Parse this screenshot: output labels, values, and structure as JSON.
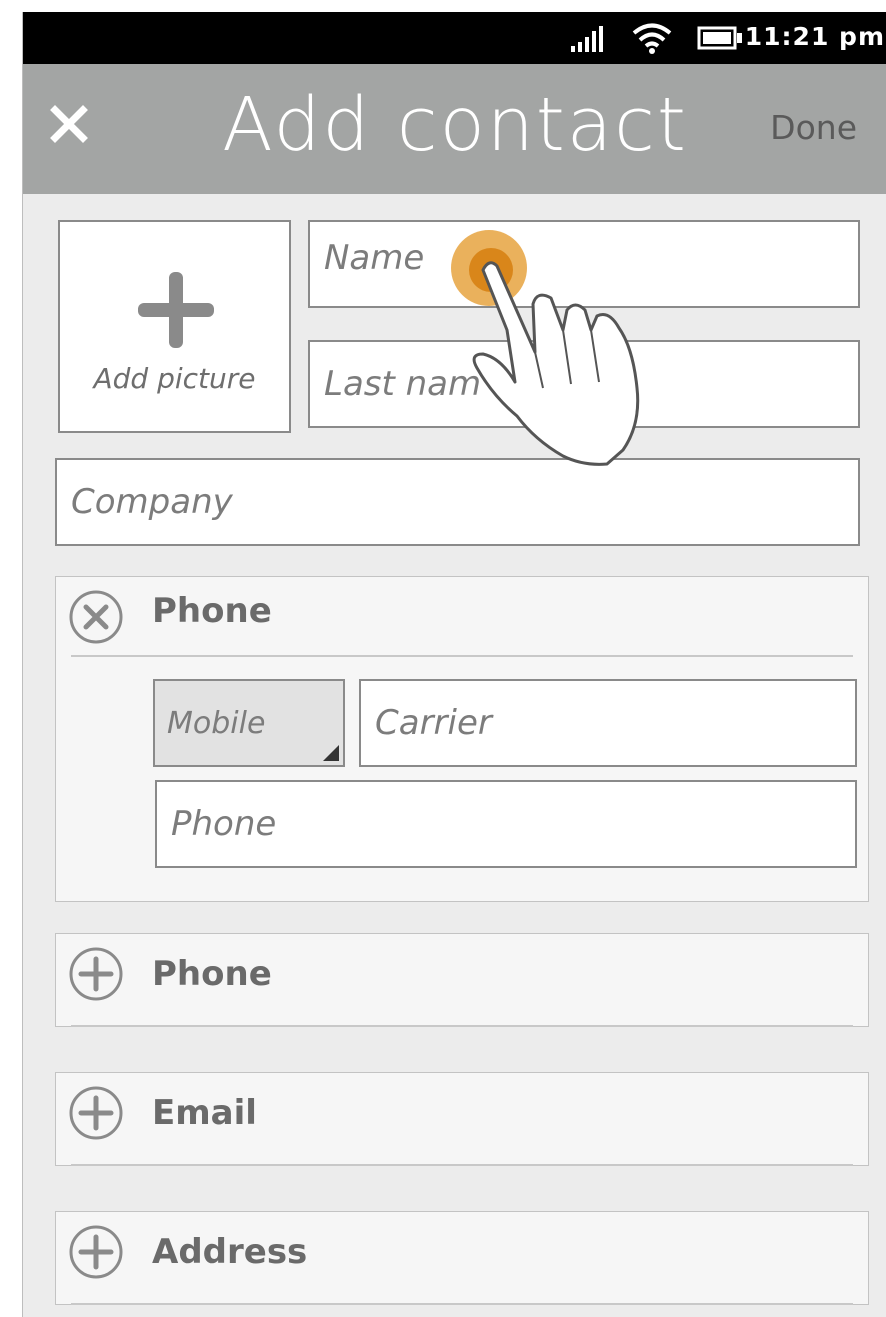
{
  "status_bar": {
    "time": "11:21 pm"
  },
  "header": {
    "title": "Add contact",
    "done_label": "Done"
  },
  "picture": {
    "label": "Add picture"
  },
  "fields": {
    "name_placeholder": "Name",
    "last_name_placeholder": "Last nam",
    "company_placeholder": "Company"
  },
  "phone_section": {
    "title": "Phone",
    "type_value": "Mobile",
    "carrier_placeholder": "Carrier",
    "phone_placeholder": "Phone"
  },
  "add_sections": [
    {
      "title": "Phone"
    },
    {
      "title": "Email"
    },
    {
      "title": "Address"
    }
  ],
  "colors": {
    "header_bg": "#a3a5a4",
    "touch_highlight": "#e8a84a",
    "touch_core": "#d9861a"
  }
}
